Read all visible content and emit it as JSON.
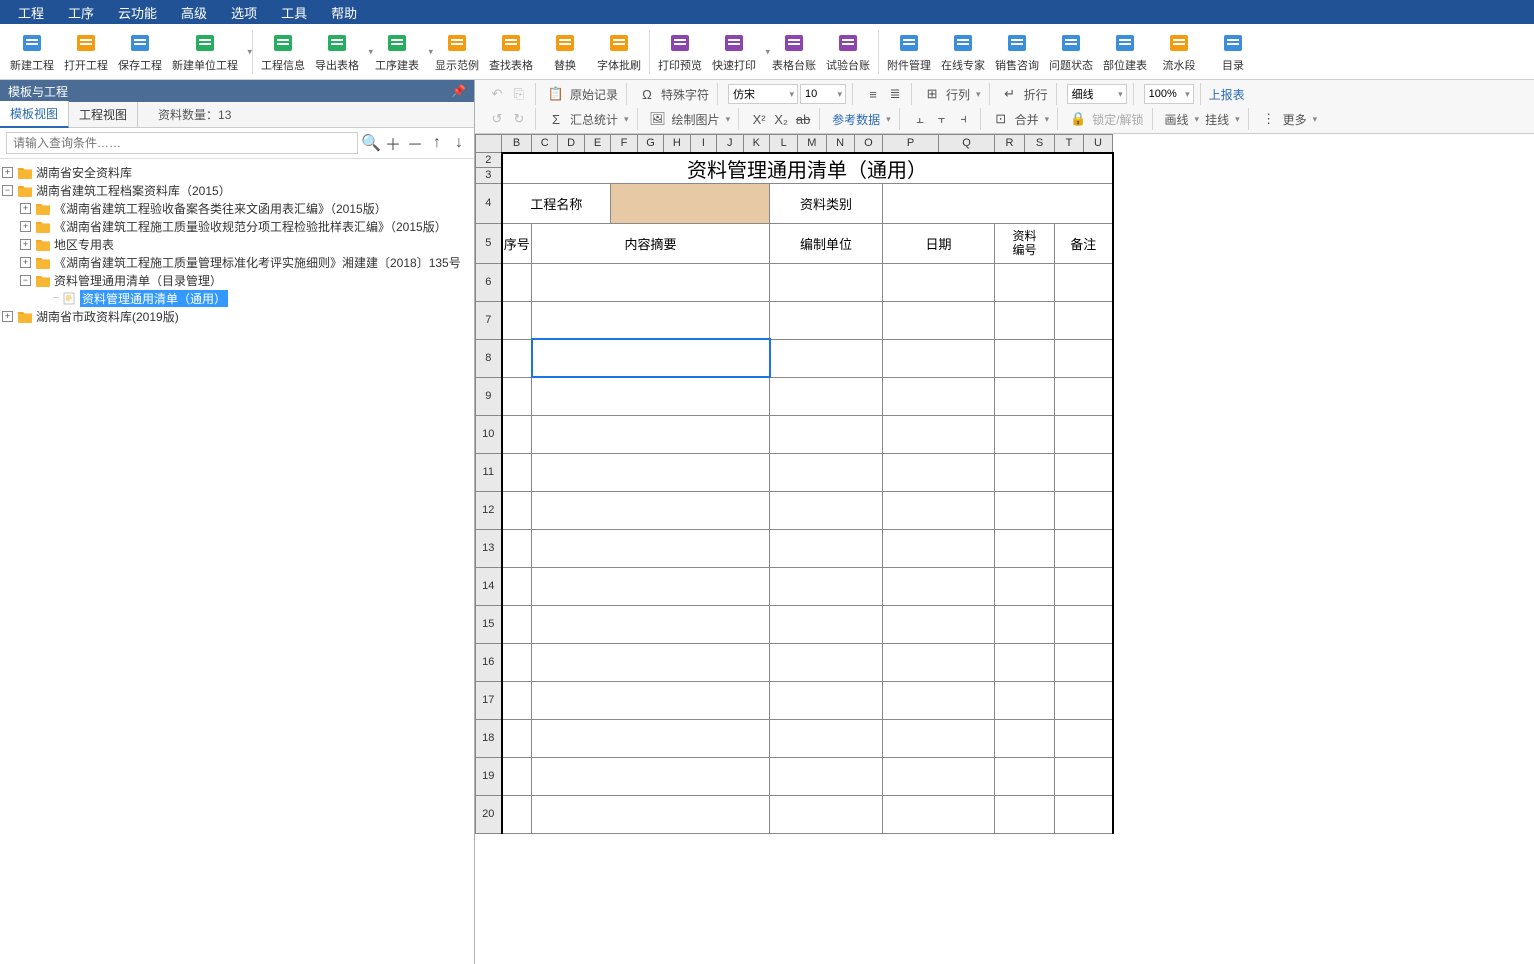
{
  "menu": [
    "工程",
    "工序",
    "云功能",
    "高级",
    "选项",
    "工具",
    "帮助"
  ],
  "toolbar": [
    {
      "id": "new-proj",
      "lbl": "新建工程",
      "icon": "doc",
      "color": "#3b8ed9"
    },
    {
      "id": "open-proj",
      "lbl": "打开工程",
      "icon": "folder",
      "color": "#f39c12"
    },
    {
      "id": "save-proj",
      "lbl": "保存工程",
      "icon": "save",
      "color": "#3b8ed9"
    },
    {
      "id": "new-unit-proj",
      "lbl": "新建单位工程",
      "icon": "home",
      "color": "#27ae60",
      "arrow": true,
      "sep": true
    },
    {
      "id": "proj-info",
      "lbl": "工程信息",
      "icon": "info",
      "color": "#27ae60"
    },
    {
      "id": "export-table",
      "lbl": "导出表格",
      "icon": "export",
      "color": "#27ae60",
      "arrow": true
    },
    {
      "id": "seq-build",
      "lbl": "工序建表",
      "icon": "build",
      "color": "#27ae60",
      "arrow": true
    },
    {
      "id": "show-template",
      "lbl": "显示范例",
      "icon": "template",
      "color": "#f39c12"
    },
    {
      "id": "find-table",
      "lbl": "查找表格",
      "icon": "search",
      "color": "#f39c12"
    },
    {
      "id": "replace",
      "lbl": "替换",
      "icon": "replace",
      "color": "#f39c12"
    },
    {
      "id": "font-review",
      "lbl": "字体批刷",
      "icon": "font",
      "color": "#f39c12",
      "sep": true
    },
    {
      "id": "print-preview",
      "lbl": "打印预览",
      "icon": "preview",
      "color": "#8e44ad"
    },
    {
      "id": "quick-print",
      "lbl": "快速打印",
      "icon": "print",
      "color": "#8e44ad",
      "arrow": true
    },
    {
      "id": "table-ledger",
      "lbl": "表格台账",
      "icon": "ledger",
      "color": "#8e44ad"
    },
    {
      "id": "test-ledger",
      "lbl": "试验台账",
      "icon": "test",
      "color": "#8e44ad",
      "sep": true
    },
    {
      "id": "attach-mgr",
      "lbl": "附件管理",
      "icon": "attach",
      "color": "#3b8ed9"
    },
    {
      "id": "online-expert",
      "lbl": "在线专家",
      "icon": "expert",
      "color": "#3b8ed9"
    },
    {
      "id": "sales",
      "lbl": "销售咨询",
      "icon": "sales",
      "color": "#3b8ed9"
    },
    {
      "id": "issue",
      "lbl": "问题状态",
      "icon": "issue",
      "color": "#3b8ed9"
    },
    {
      "id": "part-build",
      "lbl": "部位建表",
      "icon": "part",
      "color": "#3b8ed9"
    },
    {
      "id": "flow",
      "lbl": "流水段",
      "icon": "flow",
      "color": "#f39c12"
    },
    {
      "id": "catalog",
      "lbl": "目录",
      "icon": "catalog",
      "color": "#3b8ed9"
    }
  ],
  "panel": {
    "title": "模板与工程",
    "tabs": [
      "模板视图",
      "工程视图"
    ],
    "countLabel": "资料数量：",
    "countValue": "13",
    "searchPlaceholder": "请输入查询条件……",
    "tree": [
      {
        "d": 0,
        "tg": "+",
        "icon": "folder",
        "label": "湖南省安全资料库"
      },
      {
        "d": 0,
        "tg": "-",
        "icon": "folder",
        "label": "湖南省建筑工程档案资料库（2015）"
      },
      {
        "d": 1,
        "tg": "+",
        "icon": "folder",
        "label": "《湖南省建筑工程验收备案各类往来文函用表汇编》（2015版）"
      },
      {
        "d": 1,
        "tg": "+",
        "icon": "folder",
        "label": "《湖南省建筑工程施工质量验收规范分项工程检验批样表汇编》（2015版）"
      },
      {
        "d": 1,
        "tg": "+",
        "icon": "folder",
        "label": "地区专用表"
      },
      {
        "d": 1,
        "tg": "+",
        "icon": "folder",
        "label": "《湖南省建筑工程施工质量管理标准化考评实施细则》湘建建〔2018〕135号"
      },
      {
        "d": 1,
        "tg": "-",
        "icon": "folder",
        "label": "资料管理通用清单（目录管理）"
      },
      {
        "d": 2,
        "tg": "",
        "icon": "doc",
        "label": "资料管理通用清单（通用）",
        "sel": true
      },
      {
        "d": 0,
        "tg": "+",
        "icon": "folder",
        "label": "湖南省市政资料库(2019版)"
      }
    ]
  },
  "fmt": {
    "r1": {
      "orig": "原始记录",
      "spec": "特殊字符",
      "font": "仿宋",
      "size": "10",
      "row": "行列",
      "wrap": "折行",
      "line": "细线",
      "zoom": "100%",
      "upload": "上报表"
    },
    "r2": {
      "sum": "汇总统计",
      "draw": "绘制图片",
      "ref": "参考数据",
      "merge": "合并",
      "lock": "锁定/解锁",
      "frame": "画线",
      "hanging": "挂线",
      "more": "更多"
    }
  },
  "sheet": {
    "cols": [
      "",
      "B",
      "C",
      "D",
      "E",
      "F",
      "G",
      "H",
      "I",
      "J",
      "K",
      "L",
      "M",
      "N",
      "O",
      "P",
      "Q",
      "R",
      "S",
      "T",
      "U"
    ],
    "title": "资料管理通用清单（通用）",
    "h1a": "工程名称",
    "h1b": "资料类别",
    "h2": [
      "序号",
      "内容摘要",
      "编制单位",
      "日期",
      "资料\n编号",
      "备注"
    ],
    "rows": 20
  }
}
